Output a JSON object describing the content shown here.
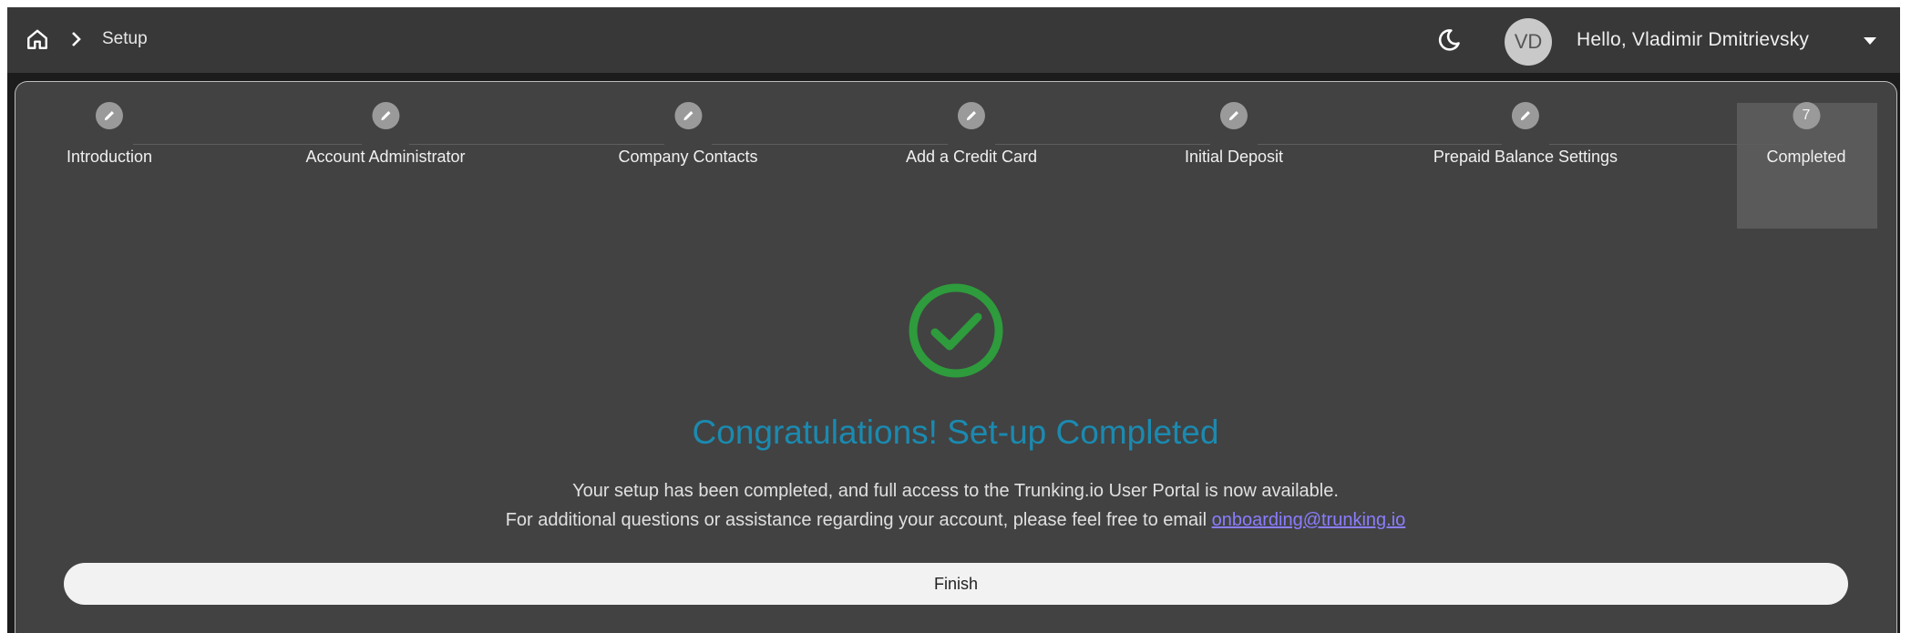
{
  "topbar": {
    "breadcrumb": "Setup",
    "avatar_initials": "VD",
    "greeting": "Hello, Vladimir Dmitrievsky",
    "icons": [
      "home-icon",
      "chevron-right-icon",
      "moon-icon",
      "caret-down-icon"
    ]
  },
  "stepper": {
    "steps": [
      {
        "label": "Introduction",
        "marker": "pencil-icon"
      },
      {
        "label": "Account Administrator",
        "marker": "pencil-icon"
      },
      {
        "label": "Company Contacts",
        "marker": "pencil-icon"
      },
      {
        "label": "Add a Credit Card",
        "marker": "pencil-icon"
      },
      {
        "label": "Initial Deposit",
        "marker": "pencil-icon"
      },
      {
        "label": "Prepaid Balance Settings",
        "marker": "pencil-icon"
      },
      {
        "label": "Completed",
        "number": "7",
        "active": true
      }
    ]
  },
  "content": {
    "title": "Congratulations! Set-up Completed",
    "line1": "Your setup has been completed, and full access to the Trunking.io User Portal is now available.",
    "line2_prefix": "For additional questions or assistance regarding your account, please feel free to email ",
    "email": "onboarding@trunking.io",
    "finish_label": "Finish"
  },
  "colors": {
    "title": "#1b8ab0",
    "check": "#2e9b3c",
    "link": "#8a7dff"
  }
}
